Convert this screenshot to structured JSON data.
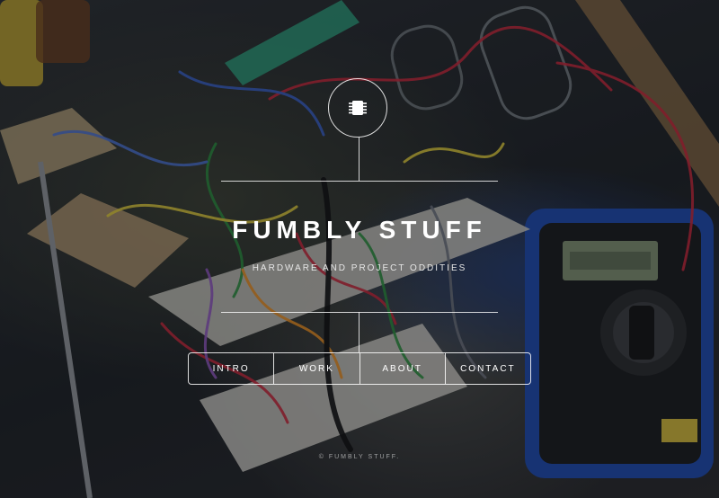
{
  "site": {
    "title": "FUMBLY STUFF",
    "subtitle": "HARDWARE AND PROJECT ODDITIES",
    "logo_icon": "chip-icon"
  },
  "nav": {
    "items": [
      {
        "label": "INTRO"
      },
      {
        "label": "WORK"
      },
      {
        "label": "ABOUT"
      },
      {
        "label": "CONTACT"
      }
    ]
  },
  "footer": {
    "copyright": "© FUMBLY STUFF."
  },
  "colors": {
    "text": "#ffffff",
    "lines": "#ffffff",
    "background": "#1e2125"
  }
}
